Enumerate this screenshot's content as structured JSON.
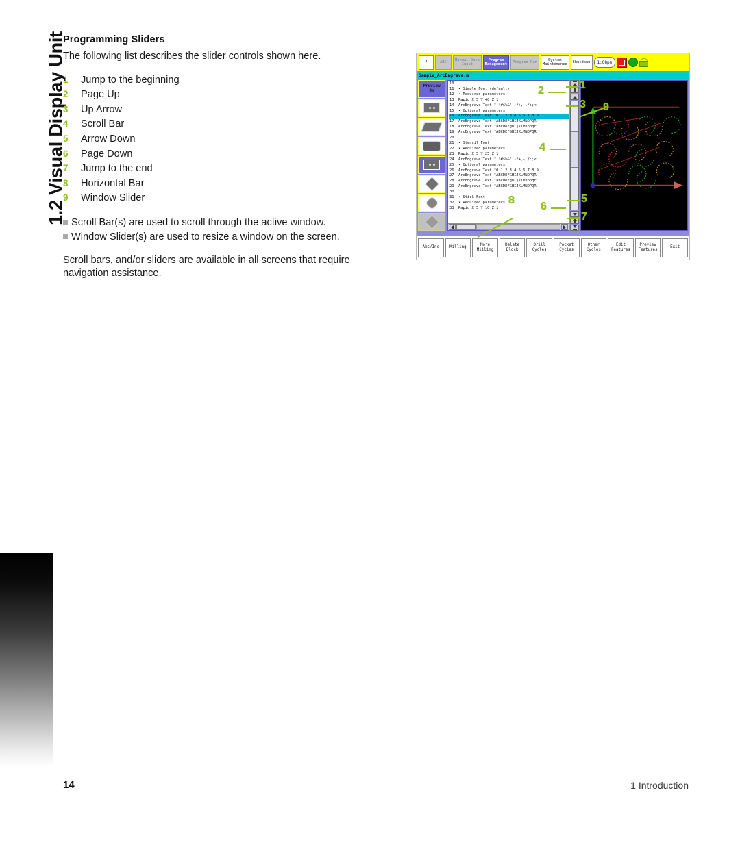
{
  "chapter_tab": "1.2 Visual Display Unit",
  "section": {
    "heading": "Programming Sliders",
    "intro": "The following list describes the slider controls shown here."
  },
  "slider_list": [
    {
      "num": "1",
      "label": "Jump to the beginning"
    },
    {
      "num": "2",
      "label": "Page Up"
    },
    {
      "num": "3",
      "label": "Up Arrow"
    },
    {
      "num": "4",
      "label": "Scroll Bar"
    },
    {
      "num": "5",
      "label": "Arrow Down"
    },
    {
      "num": "6",
      "label": "Page Down"
    },
    {
      "num": "7",
      "label": "Jump to the end"
    },
    {
      "num": "8",
      "label": "Horizontal Bar"
    },
    {
      "num": "9",
      "label": "Window Slider"
    }
  ],
  "bullets": [
    "Scroll Bar(s) are used to scroll through the active window.",
    "Window Slider(s) are used to resize a window on the screen."
  ],
  "trailer": "Scroll bars, and/or sliders are available in all screens that require navigation assistance.",
  "footer": {
    "page_number": "14",
    "chapter": "1 Introduction"
  },
  "figure": {
    "topbar": {
      "help_glyph": "?",
      "buttons": [
        {
          "label": "ABC",
          "state": "disabled"
        },
        {
          "label": "Manual Data\nInput",
          "state": "disabled"
        },
        {
          "label": "Program\nManagement",
          "state": "active"
        },
        {
          "label": "Program Run",
          "state": "disabled"
        },
        {
          "label": "System\nMaintenance",
          "state": "normal"
        },
        {
          "label": "Shutdown",
          "state": "normal"
        }
      ],
      "clock": "1:08pm",
      "estop": "estop-icon",
      "status_led": "green-led",
      "lock": "unlocked-icon"
    },
    "filename": "Sample_ArcEngrave.m",
    "rail": {
      "preview_label": "Preview\nOn",
      "icons": [
        "chip-icon",
        "slab-icon",
        "rounded-slab-icon",
        "frame-icon",
        "diamond-icon",
        "rounded-diamond-icon",
        "disabled-diamond-icon"
      ]
    },
    "code_lines": [
      {
        "n": "10",
        "text": ""
      },
      {
        "n": "11",
        "text": "• Simple Font (default)"
      },
      {
        "n": "12",
        "text": "• Required parameters"
      },
      {
        "n": "13",
        "text": "Rapid X 5 Y 40 Z 1"
      },
      {
        "n": "14",
        "text": "ArcEngrave Text \" !#$%&'()*+,-./:;<"
      },
      {
        "n": "15",
        "text": "• Optional parameters"
      },
      {
        "n": "16",
        "text": "ArcEngrave Text \"0 1 2 3 4 5 6 7 8 9",
        "highlight": true
      },
      {
        "n": "17",
        "text": "ArcEngrave Text \"ABCDEFGHIJKLMNOPQR"
      },
      {
        "n": "18",
        "text": "ArcEngrave Text \"abcdefghijklmnopqr"
      },
      {
        "n": "19",
        "text": "ArcEngrave Text \"ABCDEFGHIJKLMNOPQR"
      },
      {
        "n": "20",
        "text": ""
      },
      {
        "n": "21",
        "text": "• Stencil Font"
      },
      {
        "n": "22",
        "text": "• Required parameters"
      },
      {
        "n": "23",
        "text": "Rapid X 5 Y 25 Z 1"
      },
      {
        "n": "24",
        "text": "ArcEngrave Text \" !#$%&'()*+,-./:;<"
      },
      {
        "n": "25",
        "text": "• Optional parameters"
      },
      {
        "n": "26",
        "text": "ArcEngrave Text \"0 1 2 3 4 5 6 7 8 9"
      },
      {
        "n": "27",
        "text": "ArcEngrave Text \"ABCDEFGHIJKLMNOPQR"
      },
      {
        "n": "28",
        "text": "ArcEngrave Text \"abcdefghijklmnopqr"
      },
      {
        "n": "29",
        "text": "ArcEngrave Text \"ABCDEFGHIJKLMNOPQR"
      },
      {
        "n": "30",
        "text": ""
      },
      {
        "n": "31",
        "text": "• Stick Font"
      },
      {
        "n": "32",
        "text": "• Required parameters"
      },
      {
        "n": "33",
        "text": "Rapid X 5 Y 10 Z 1"
      }
    ],
    "softkeys": [
      "Abs/Inc",
      "Milling",
      "More\nMilling",
      "Delete\nBlock",
      "Drill\nCycles",
      "Pocket\nCycles",
      "Other\nCycles",
      "Edit\nFeatures",
      "Preview\nFeatures",
      "Exit"
    ],
    "callouts": [
      "1",
      "2",
      "3",
      "4",
      "5",
      "6",
      "7",
      "8",
      "9"
    ]
  },
  "colors": {
    "accent_green": "#93c020",
    "toolbar_yellow": "#ffff00",
    "active_blue": "#6b66d6",
    "filename_cyan": "#00cccc"
  }
}
